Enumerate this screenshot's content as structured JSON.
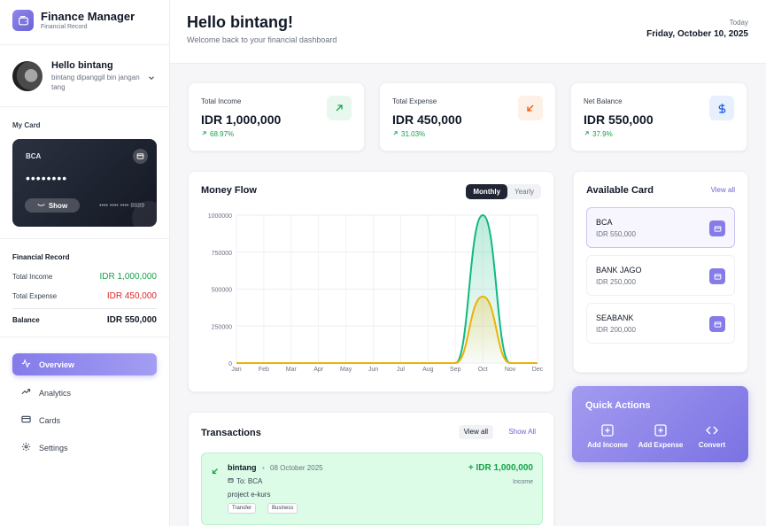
{
  "app": {
    "title": "Finance Manager",
    "subtitle": "Financial Record"
  },
  "profile": {
    "name": "Hello bintang",
    "description": "bintang dipanggil bin jangan tang"
  },
  "my_card": {
    "label": "My Card",
    "bank": "BCA",
    "masked": "••••••••",
    "show_label": "Show",
    "number": "•••• •••• •••• 8889"
  },
  "financial_record": {
    "title": "Financial Record",
    "income_label": "Total Income",
    "income_value": "IDR 1,000,000",
    "expense_label": "Total Expense",
    "expense_value": "IDR 450,000",
    "balance_label": "Balance",
    "balance_value": "IDR 550,000"
  },
  "nav": [
    {
      "label": "Overview",
      "icon": "activity-icon",
      "active": true
    },
    {
      "label": "Analytics",
      "icon": "trending-up-icon",
      "active": false
    },
    {
      "label": "Cards",
      "icon": "credit-card-icon",
      "active": false
    },
    {
      "label": "Settings",
      "icon": "gear-icon",
      "active": false
    }
  ],
  "header": {
    "greeting": "Hello bintang!",
    "welcome": "Welcome back to your financial dashboard",
    "today_label": "Today",
    "date": "Friday, October 10, 2025"
  },
  "stats": [
    {
      "label": "Total Income",
      "value": "IDR 1,000,000",
      "change": "68.97%",
      "icon": "arrow-up-right-icon",
      "color": "#16a34a"
    },
    {
      "label": "Total Expense",
      "value": "IDR 450,000",
      "change": "31.03%",
      "icon": "arrow-down-left-icon",
      "color": "#ea580c"
    },
    {
      "label": "Net Balance",
      "value": "IDR 550,000",
      "change": "37.9%",
      "icon": "dollar-icon",
      "color": "#2563eb"
    }
  ],
  "money_flow": {
    "title": "Money Flow",
    "toggle": [
      "Monthly",
      "Yearly"
    ],
    "active_toggle": "Monthly"
  },
  "chart_data": {
    "type": "area",
    "categories": [
      "Jan",
      "Feb",
      "Mar",
      "Apr",
      "May",
      "Jun",
      "Jul",
      "Aug",
      "Sep",
      "Oct",
      "Nov",
      "Dec"
    ],
    "series": [
      {
        "values": [
          0,
          0,
          0,
          0,
          0,
          0,
          0,
          0,
          0,
          1000000,
          0,
          0
        ],
        "color": "#10b981"
      },
      {
        "values": [
          0,
          0,
          0,
          0,
          0,
          0,
          0,
          0,
          0,
          450000,
          0,
          0
        ],
        "color": "#eab308"
      }
    ],
    "yticks": [
      "1000000",
      "750000",
      "500000",
      "250000",
      "0"
    ],
    "ylim": [
      0,
      1000000
    ],
    "grid": true
  },
  "available_cards": {
    "title": "Available Card",
    "view_all": "View all",
    "items": [
      {
        "name": "BCA",
        "balance": "IDR 550,000",
        "selected": true
      },
      {
        "name": "BANK JAGO",
        "balance": "IDR 250,000",
        "selected": false
      },
      {
        "name": "SEABANK",
        "balance": "IDR 200,000",
        "selected": false
      }
    ]
  },
  "quick_actions": {
    "title": "Quick Actions",
    "items": [
      {
        "label": "Add Income",
        "icon": "plus-square-icon"
      },
      {
        "label": "Add Expense",
        "icon": "plus-square-icon"
      },
      {
        "label": "Convert",
        "icon": "convert-icon"
      }
    ]
  },
  "transactions": {
    "title": "Transactions",
    "view_all": "View all",
    "show_all": "Show All",
    "items": [
      {
        "name": "bintang",
        "date": "08 October 2025",
        "to": "To: BCA",
        "note": "project e-kurs",
        "tags": [
          "Transfer",
          "Business"
        ],
        "amount": "+ IDR 1,000,000",
        "type": "Income"
      }
    ]
  }
}
